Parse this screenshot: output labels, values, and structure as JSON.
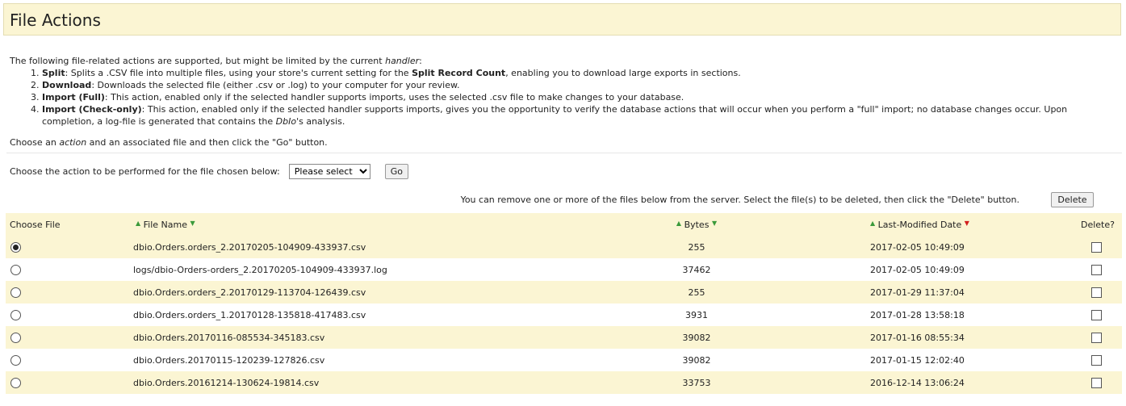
{
  "page_title": "File Actions",
  "intro": {
    "lead": "The following file-related actions are supported, but might be limited by the current ",
    "lead_em": "handler",
    "lead_end": ":",
    "items": [
      {
        "name": "Split",
        "parts": [
          ": Splits a .CSV file into multiple files, using your store's current setting for the ",
          {
            "strong": "Split Record Count"
          },
          ", enabling you to download large exports in sections."
        ]
      },
      {
        "name": "Download",
        "parts": [
          ": Downloads the selected file (either .csv or .log) to your computer for your review."
        ]
      },
      {
        "name": "Import (Full)",
        "parts": [
          ": This action, enabled only if the selected handler supports imports, uses the selected .csv file to make changes to your database."
        ]
      },
      {
        "name": "Import (Check-only)",
        "parts": [
          ": This action, enabled only if the selected handler supports imports, gives you the opportunity to verify the database actions that will occur when you perform a \"full\" import; no database changes occur. Upon completion, a log-file is generated that contains the ",
          {
            "em": "DbIo"
          },
          "'s analysis."
        ]
      }
    ],
    "choose_pre": "Choose an ",
    "choose_em": "action",
    "choose_post": " and an associated file and then click the \"Go\" button."
  },
  "action": {
    "label": "Choose the action to be performed for the file chosen below:",
    "select_value": "Please select",
    "go_label": "Go"
  },
  "delete_bar": {
    "message": "You can remove one or more of the files below from the server. Select the file(s) to be deleted, then click the \"Delete\" button.",
    "button_label": "Delete"
  },
  "table": {
    "headers": {
      "choose": "Choose File",
      "name": "File Name",
      "bytes": "Bytes",
      "date": "Last-Modified Date",
      "delete": "Delete?"
    },
    "sorted_column": "date",
    "sort_up_icon": "▲",
    "sort_down_icon": "▼",
    "rows": [
      {
        "name": "dbio.Orders.orders_2.20170205-104909-433937.csv",
        "bytes": "255",
        "date": "2017-02-05 10:49:09",
        "selected": true,
        "delete": false
      },
      {
        "name": "logs/dbio-Orders-orders_2.20170205-104909-433937.log",
        "bytes": "37462",
        "date": "2017-02-05 10:49:09",
        "selected": false,
        "delete": false
      },
      {
        "name": "dbio.Orders.orders_2.20170129-113704-126439.csv",
        "bytes": "255",
        "date": "2017-01-29 11:37:04",
        "selected": false,
        "delete": false
      },
      {
        "name": "dbio.Orders.orders_1.20170128-135818-417483.csv",
        "bytes": "3931",
        "date": "2017-01-28 13:58:18",
        "selected": false,
        "delete": false
      },
      {
        "name": "dbio.Orders.20170116-085534-345183.csv",
        "bytes": "39082",
        "date": "2017-01-16 08:55:34",
        "selected": false,
        "delete": false
      },
      {
        "name": "dbio.Orders.20170115-120239-127826.csv",
        "bytes": "39082",
        "date": "2017-01-15 12:02:40",
        "selected": false,
        "delete": false
      },
      {
        "name": "dbio.Orders.20161214-130624-19814.csv",
        "bytes": "33753",
        "date": "2016-12-14 13:06:24",
        "selected": false,
        "delete": false
      }
    ]
  },
  "colors": {
    "header_bg": "#fbf5d3",
    "stripe_bg": "#fbf5d3",
    "sort_green": "#3a9a3a",
    "sort_active_red": "#d21d1d"
  }
}
